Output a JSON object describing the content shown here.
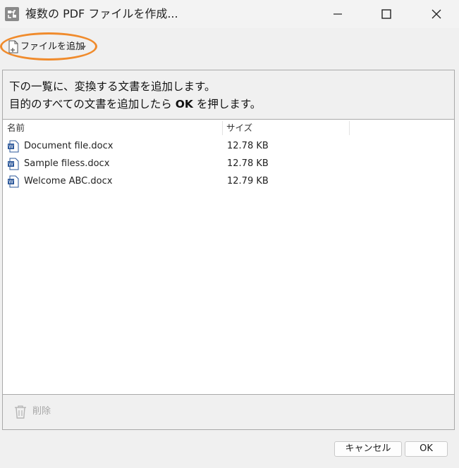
{
  "window": {
    "title": "複数の PDF ファイルを作成...",
    "icons": {
      "app": "pdf-merge-icon",
      "minimize": "minimize-icon",
      "maximize": "maximize-icon",
      "close": "close-icon"
    }
  },
  "toolbar": {
    "add_file_label": "ファイルを追加",
    "add_file_icon": "add-file-icon",
    "dropdown_icon": "chevron-down-icon",
    "highlight_color": "#f08b2c"
  },
  "instructions": {
    "line1": "下の一覧に、変換する文書を追加します。",
    "line2_before": "目的のすべての文書を追加したら ",
    "line2_bold": "OK",
    "line2_after": " を押します。"
  },
  "file_list": {
    "columns": {
      "name": "名前",
      "size": "サイズ"
    },
    "rows": [
      {
        "name": "Document file.docx",
        "size": "12.78 KB",
        "icon": "word-file-icon"
      },
      {
        "name": "Sample filess.docx",
        "size": "12.78 KB",
        "icon": "word-file-icon"
      },
      {
        "name": "Welcome ABC.docx",
        "size": "12.79 KB",
        "icon": "word-file-icon"
      }
    ]
  },
  "actions": {
    "delete_label": "削除",
    "delete_icon": "trash-icon"
  },
  "buttons": {
    "cancel": "キャンセル",
    "ok": "OK"
  }
}
